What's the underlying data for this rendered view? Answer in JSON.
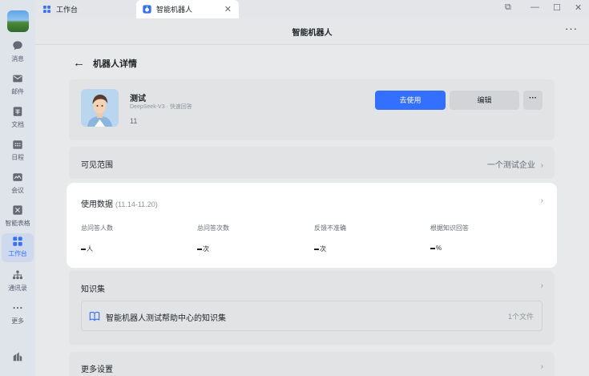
{
  "rail": {
    "items": [
      {
        "label": "消息",
        "icon": "chat-bubble-icon"
      },
      {
        "label": "邮件",
        "icon": "mail-icon"
      },
      {
        "label": "文档",
        "icon": "document-icon"
      },
      {
        "label": "日程",
        "icon": "calendar-icon"
      },
      {
        "label": "会议",
        "icon": "meeting-icon"
      },
      {
        "label": "智能表格",
        "icon": "table-icon"
      },
      {
        "label": "工作台",
        "icon": "workbench-icon"
      },
      {
        "label": "通讯录",
        "icon": "contacts-icon"
      },
      {
        "label": "更多",
        "icon": "more-dots-icon"
      }
    ]
  },
  "tabs": [
    {
      "label": "工作台"
    },
    {
      "label": "智能机器人"
    }
  ],
  "header": {
    "title": "智能机器人",
    "more": "···"
  },
  "page": {
    "back_title": "机器人详情"
  },
  "bot": {
    "name": "测试",
    "model": "DeepSeek-V3 · 快速回答",
    "number": "11",
    "use_label": "去使用",
    "edit_label": "编辑",
    "more_label": "···"
  },
  "scope": {
    "label": "可见范围",
    "value": "一个测试企业"
  },
  "usage": {
    "label": "使用数据",
    "range": "(11.14-11.20)",
    "stats": [
      {
        "label": "总问答人数",
        "unit": "人"
      },
      {
        "label": "总问答次数",
        "unit": "次"
      },
      {
        "label": "反馈不准确",
        "unit": "次"
      },
      {
        "label": "根据知识回答",
        "unit": "%"
      }
    ]
  },
  "knowledge": {
    "label": "知识集",
    "item_name": "智能机器人测试帮助中心的知识集",
    "item_count": "1个文件"
  },
  "more_settings": {
    "label": "更多设置"
  },
  "colors": {
    "accent": "#3370ff",
    "rail_bg": "#dfe3ea",
    "card_bg": "#e2e3e5"
  }
}
